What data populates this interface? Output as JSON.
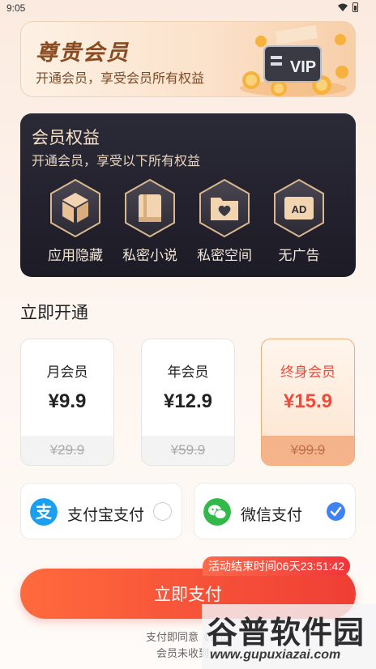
{
  "status_bar": {
    "time": "9:05"
  },
  "banner": {
    "title": "尊贵会员",
    "subtitle": "开通会员，享受会员所有权益",
    "art_text": "VIP"
  },
  "benefits": {
    "title": "会员权益",
    "subtitle": "开通会员，享受以下所有权益",
    "items": [
      {
        "label": "应用隐藏",
        "icon": "box-icon"
      },
      {
        "label": "私密小说",
        "icon": "book-icon"
      },
      {
        "label": "私密空间",
        "icon": "heart-folder-icon"
      },
      {
        "label": "无广告",
        "icon": "ad-icon",
        "icon_text": "AD"
      }
    ]
  },
  "plans": {
    "section_title": "立即开通",
    "items": [
      {
        "name": "月会员",
        "price": "¥9.9",
        "original": "¥29.9"
      },
      {
        "name": "年会员",
        "price": "¥12.9",
        "original": "¥59.9"
      },
      {
        "name": "终身会员",
        "price": "¥15.9",
        "original": "¥99.9",
        "selected": true
      }
    ]
  },
  "payment": {
    "options": [
      {
        "label": "支付宝支付",
        "icon": "alipay-icon",
        "icon_text": "支",
        "checked": false
      },
      {
        "label": "微信支付",
        "icon": "wechat-icon",
        "checked": true
      }
    ]
  },
  "countdown": "活动结束时间06天23:51:42",
  "pay_button": "立即支付",
  "agreement": {
    "line1": "支付即同意《会员",
    "line2": "会员未收到，"
  },
  "watermark": {
    "main": "谷普软件园",
    "url": "www.gupuxiazai.com"
  },
  "colors": {
    "accent": "#ef3e35",
    "gold": "#8a4b21",
    "dark_card": "#1c1b26",
    "check_blue": "#3f82f5"
  }
}
